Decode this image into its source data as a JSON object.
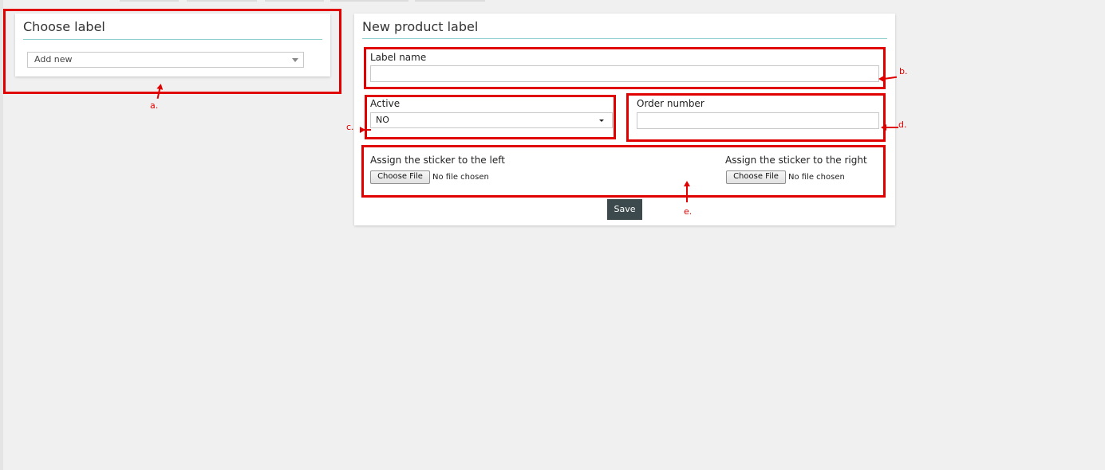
{
  "choose_panel": {
    "title": "Choose label",
    "select_value": "Add new"
  },
  "new_panel": {
    "title": "New product label",
    "label_name": {
      "label": "Label name",
      "value": ""
    },
    "active": {
      "label": "Active",
      "value": "NO"
    },
    "order_number": {
      "label": "Order number",
      "value": ""
    },
    "sticker_left": {
      "label": "Assign the sticker to the left",
      "button": "Choose File",
      "status": "No file chosen"
    },
    "sticker_right": {
      "label": "Assign the sticker to the right",
      "button": "Choose File",
      "status": "No file chosen"
    },
    "save_label": "Save"
  },
  "annotations": {
    "a": "a.",
    "b": "b.",
    "c": "c.",
    "d": "d.",
    "e": "e."
  },
  "colors": {
    "annotation_red": "#e00000",
    "rule_teal": "#8fcfcf",
    "save_button_bg": "#3d4a4d"
  }
}
